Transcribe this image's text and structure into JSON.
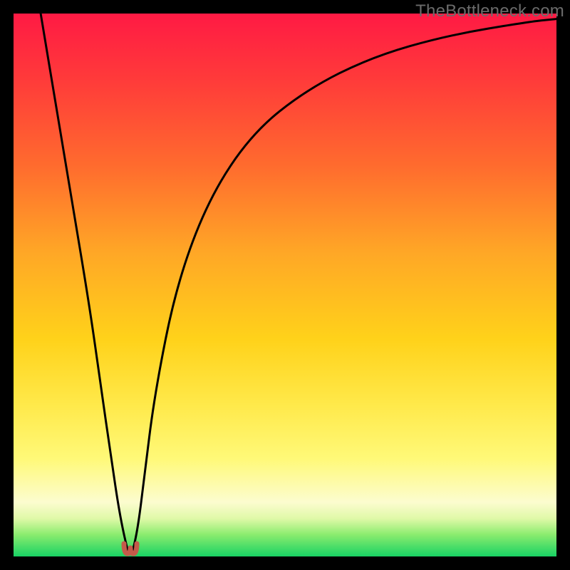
{
  "watermark_text": "TheBottleneck.com",
  "chart_data": {
    "type": "line",
    "title": "",
    "xlabel": "",
    "ylabel": "",
    "xlim": [
      0,
      100
    ],
    "ylim": [
      0,
      100
    ],
    "series": [
      {
        "name": "bottleneck-curve",
        "x": [
          5,
          8,
          11,
          14,
          16,
          18,
          19.5,
          21,
          21.5,
          22,
          23,
          24,
          26,
          30,
          36,
          44,
          54,
          66,
          80,
          95,
          100
        ],
        "values": [
          100,
          82,
          64,
          46,
          32,
          18,
          8,
          1,
          0.5,
          1,
          6,
          14,
          30,
          50,
          66,
          78,
          86,
          92,
          96,
          98.5,
          99
        ]
      }
    ],
    "gradient_stops": [
      {
        "pos": 0,
        "color": "#ff1a44"
      },
      {
        "pos": 12,
        "color": "#ff3a3a"
      },
      {
        "pos": 28,
        "color": "#ff6b2e"
      },
      {
        "pos": 44,
        "color": "#ffa726"
      },
      {
        "pos": 60,
        "color": "#ffd21a"
      },
      {
        "pos": 72,
        "color": "#ffe94a"
      },
      {
        "pos": 82,
        "color": "#fff978"
      },
      {
        "pos": 90,
        "color": "#fcfccf"
      },
      {
        "pos": 93,
        "color": "#e0f9a8"
      },
      {
        "pos": 96,
        "color": "#8aec6e"
      },
      {
        "pos": 100,
        "color": "#18d264"
      }
    ],
    "optimal_point": {
      "x": 21.5,
      "y": 0.5,
      "color": "#c45a4a"
    }
  }
}
